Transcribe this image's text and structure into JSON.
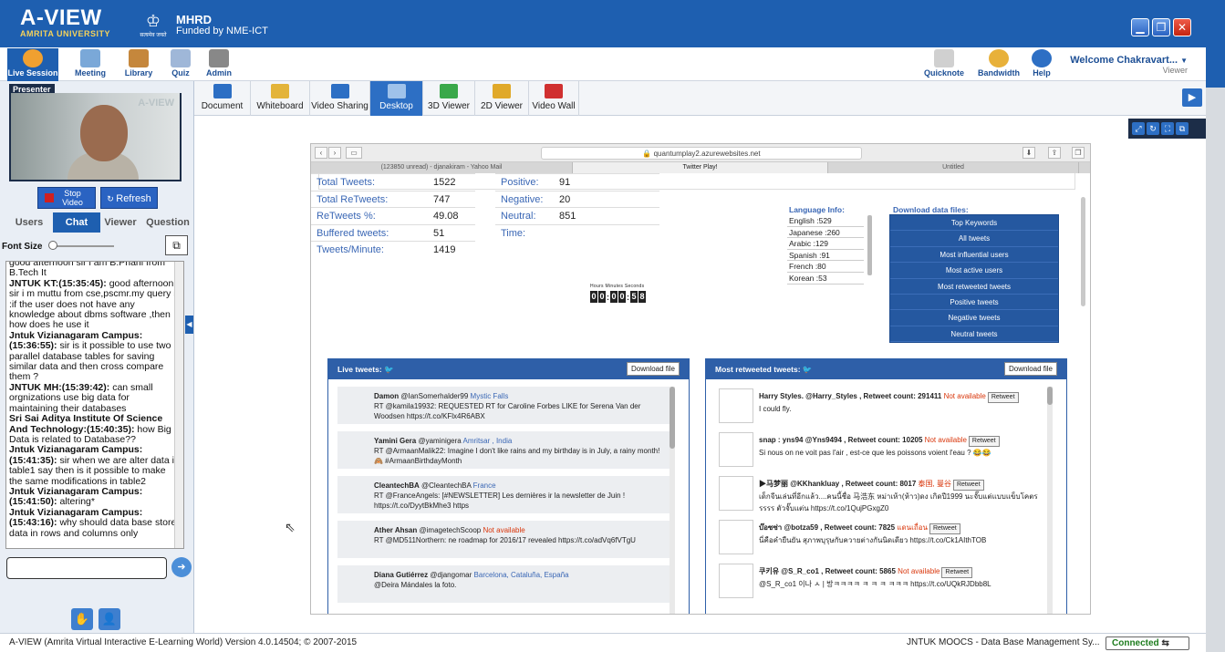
{
  "app": {
    "logo_title": "A-VIEW",
    "logo_subtitle": "AMRITA UNIVERSITY",
    "ministry": "MHRD",
    "funding": "Funded by NME-ICT",
    "emblem_text": "सत्यमेव जयते"
  },
  "window_buttons": [
    "minimize",
    "restore",
    "close"
  ],
  "toolbar": {
    "left": [
      "Live Session",
      "Meeting",
      "Library",
      "Quiz",
      "Admin"
    ],
    "right": [
      "Quicknote",
      "Bandwidth",
      "Help"
    ]
  },
  "welcome": {
    "text": "Welcome Chakravart...",
    "role": "Viewer"
  },
  "presenter": {
    "label": "Presenter",
    "watermark": "A-VIEW",
    "stop_video": "Stop Video",
    "refresh": "Refresh"
  },
  "side_tabs": [
    "Users",
    "Chat",
    "Viewer",
    "Question"
  ],
  "font_size_label": "Font Size",
  "chat": [
    {
      "author": "",
      "text": "good afternoon sir i am B.Phani from B.Tech It"
    },
    {
      "author": "JNTUK KT:(15:35:45):",
      "text": "good afternoon sir i m muttu from cse,pscmr.my query is :if the user does not have any knowledge about dbms software ,then how does he use it"
    },
    {
      "author": "Jntuk Vizianagaram Campus:(15:36:55):",
      "text": "sir is it possible to use two parallel database tables for saving similar data and then cross compare them ?"
    },
    {
      "author": "JNTUK MH:(15:39:42):",
      "text": "can small orgnizations use big data for maintaining their databases"
    },
    {
      "author": "Sri Sai Aditya Institute Of Science And Technology:(15:40:35):",
      "text": "how Big Data is related to Database??"
    },
    {
      "author": "Jntuk Vizianagaram Campus:(15:41:35):",
      "text": "sir when we are alter data in table1 say then is it possible to make the same modifications in table2"
    },
    {
      "author": "Jntuk Vizianagaram Campus:(15:41:50):",
      "text": "altering*"
    },
    {
      "author": "Jntuk Vizianagaram Campus:(15:43:16):",
      "text": "why should data base store data in rows and columns only"
    }
  ],
  "content_tabs": [
    "Document",
    "Whiteboard",
    "Video Sharing",
    "Desktop",
    "3D Viewer",
    "2D Viewer",
    "Video Wall"
  ],
  "browser": {
    "url": "quantumplay2.azurewebsites.net",
    "tabs": [
      "(123850 unread) - djanakiram - Yahoo Mail",
      "Twitter Play!",
      "Untitled"
    ]
  },
  "stats_left": [
    {
      "label": "Total Tweets:",
      "value": "1522"
    },
    {
      "label": "Total ReTweets:",
      "value": "747"
    },
    {
      "label": "ReTweets %:",
      "value": "49.08"
    },
    {
      "label": "Buffered tweets:",
      "value": "51"
    },
    {
      "label": "Tweets/Minute:",
      "value": "1419"
    }
  ],
  "stats_right": [
    {
      "label": "Positive:",
      "value": "91"
    },
    {
      "label": "Negative:",
      "value": "20"
    },
    {
      "label": "Neutral:",
      "value": "851"
    },
    {
      "label": "Time:",
      "value": ""
    }
  ],
  "timer": {
    "header": "Hours  Minutes  Seconds",
    "digits": [
      "0",
      "0",
      "0",
      "0",
      "5",
      "8"
    ]
  },
  "language": {
    "title": "Language Info:",
    "items": [
      "English :529",
      "Japanese :260",
      "Arabic :129",
      "Spanish :91",
      "French :80",
      "Korean :53"
    ]
  },
  "downloads": {
    "title": "Download data files:",
    "buttons": [
      "Top Keywords",
      "All tweets",
      "Most influential users",
      "Most active users",
      "Most retweeted tweets",
      "Positive tweets",
      "Negative tweets",
      "Neutral tweets"
    ]
  },
  "live_tweets": {
    "title": "Live tweets:",
    "download": "Download file",
    "items": [
      {
        "user": "Damon",
        "handle": "@IanSomerhalder99",
        "location": "Mystic Falls",
        "na": "",
        "text": "RT @kamila19932: REQUESTED RT for Caroline Forbes LIKE for Serena Van der Woodsen https://t.co/KFlx4R6ABX"
      },
      {
        "user": "Yamini Gera",
        "handle": "@yaminigera",
        "location": "Amritsar , India",
        "na": "",
        "text": "RT @ArmaanMalik22: Imagine I don't like rains and my birthday is in July, a rainy month! 🙈 #ArmaanBirthdayMonth"
      },
      {
        "user": "CleantechBA",
        "handle": "@CleantechBA",
        "location": "France",
        "na": "",
        "text": "RT @FranceAngels: [#NEWSLETTER] Les dernières ir la newsletter de Juin ! https://t.co/DyytBkMhe3 https"
      },
      {
        "user": "Ather Ahsan",
        "handle": "@imagetechScoop",
        "location": "",
        "na": "Not available",
        "text": "RT @MD511Northern: ne roadmap for 2016/17 revealed https://t.co/adVq6fVTgU"
      },
      {
        "user": "Diana Gutiérrez",
        "handle": "@djangomar",
        "location": "Barcelona, Cataluña, España",
        "na": "",
        "text": "@Deira Mándales la foto."
      }
    ]
  },
  "retweeted": {
    "title": "Most retweeted tweets:",
    "download": "Download file",
    "retweet_label": "Retweet",
    "items": [
      {
        "head": "Harry Styles. @Harry_Styles , Retweet count: 291411",
        "loc": "Not available",
        "loc_na": true,
        "text": "I could fly."
      },
      {
        "head": "snap : yns94 @Yns9494 , Retweet count: 10205",
        "loc": "Not available",
        "loc_na": true,
        "text": "Si nous on ne voit pas l'air , est-ce que les poissons voient l'eau ? 😂😂"
      },
      {
        "head": "▶马梦丽 @KKhankluay , Retweet count: 8017",
        "loc": "泰国, 曼谷",
        "loc_na": true,
        "text": "เด็กจีนเล่นที่อีกแล้ว....คนนี้ชื่อ 马浩东 หม่าเห้า(ห้าว)ดง เกิดปี1999 นะจั๊บแต่แบบแข็บโคตร รรรร ตัวจั๊บแต่น https://t.co/1QujPGxgZ0"
      },
      {
        "head": "บ๊อซซ่า @botza59 , Retweet count: 7825",
        "loc": "แดนเถื่อน",
        "loc_na": true,
        "text": "นี่คือคำยืนยัน สุภาพบุรุษกับควายต่างกันนิดเดียว https://t.co/Ck1AIthTOB"
      },
      {
        "head": "쿠키유 @S_R_co1 , Retweet count: 5865",
        "loc": "Not available",
        "loc_na": true,
        "text": "@S_R_co1 이나 ㅅ | 방ㅋㅋㅋㅋ ㅋ ㅋ ㅋ ㅋㅋㅋ https://t.co/UQkRJDbb8L"
      }
    ]
  },
  "status": {
    "version": "A-VIEW (Amrita Virtual Interactive E-Learning World) Version 4.0.14504; © 2007-2015",
    "course": "JNTUK MOOCS - Data Base Management Sy...",
    "connection": "Connected"
  },
  "colors": {
    "brand_blue": "#1e5fb0",
    "link_blue": "#3a67b5",
    "not_available_red": "#d9360b",
    "connected_green": "#1d7c1d"
  }
}
